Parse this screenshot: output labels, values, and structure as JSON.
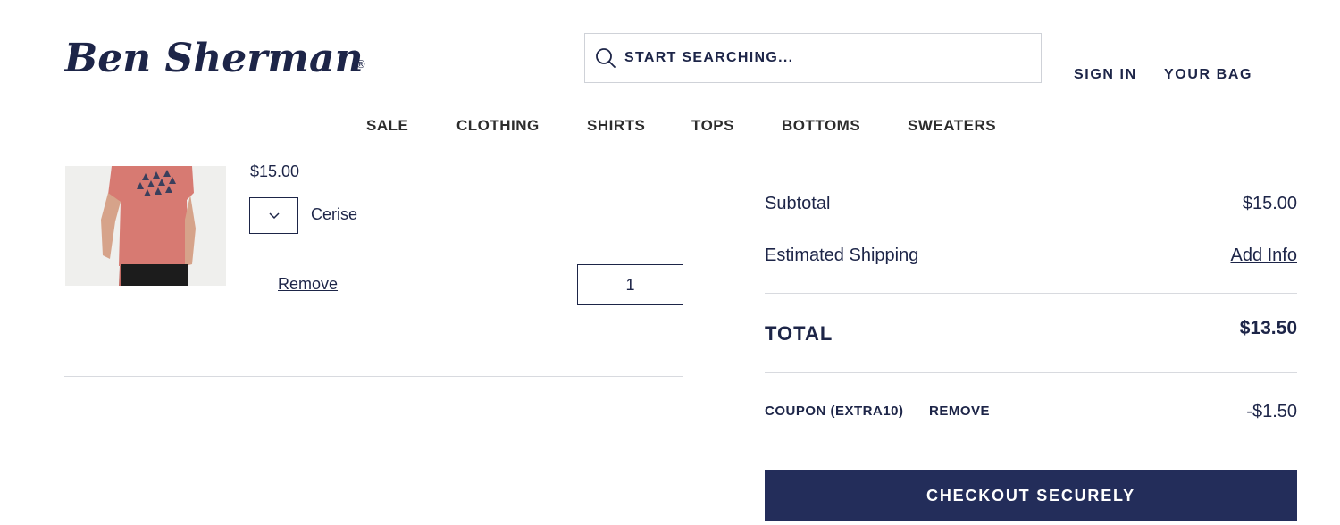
{
  "brand": {
    "name": "Ben Sherman",
    "logo_text": "Ben Sherman",
    "mark": "®"
  },
  "search": {
    "placeholder": "START SEARCHING...",
    "icon": "search-icon"
  },
  "header": {
    "sign_in": "SIGN IN",
    "bag": "YOUR BAG"
  },
  "nav": {
    "items": [
      {
        "label": "SALE"
      },
      {
        "label": "CLOTHING"
      },
      {
        "label": "SHIRTS"
      },
      {
        "label": "TOPS"
      },
      {
        "label": "BOTTOMS"
      },
      {
        "label": "SWEATERS"
      }
    ]
  },
  "cart": {
    "item": {
      "price": "$15.00",
      "color": "Cerise",
      "color_select_icon": "chevron-down-icon",
      "remove_label": "Remove",
      "quantity": "1",
      "image": "product-image"
    }
  },
  "summary": {
    "subtotal_label": "Subtotal",
    "subtotal_value": "$15.00",
    "shipping_label": "Estimated Shipping",
    "shipping_action": "Add Info",
    "total_label": "TOTAL",
    "total_value": "$13.50",
    "coupon_label": "COUPON (EXTRA10)",
    "coupon_remove": "REMOVE",
    "coupon_value": "-$1.50",
    "checkout_label": "CHECKOUT SECURELY"
  },
  "colors": {
    "navy": "#1d2548",
    "checkout_bg": "#232d5a",
    "divider": "#d8dadf"
  }
}
